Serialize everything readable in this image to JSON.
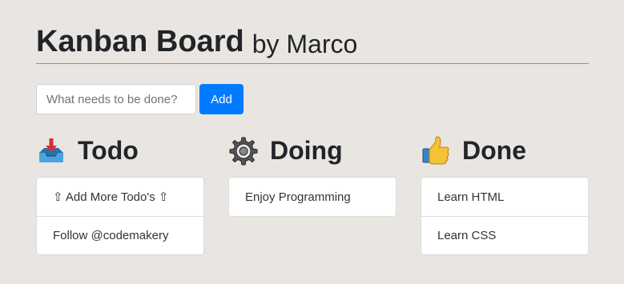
{
  "header": {
    "title": "Kanban Board",
    "subtitle": "by Marco"
  },
  "add_form": {
    "placeholder": "What needs to be done?",
    "value": "",
    "button_label": "Add",
    "button_color": "#007bff"
  },
  "columns": [
    {
      "title": "Todo",
      "icon": "inbox-tray-icon",
      "items": [
        "⇧ Add More Todo's ⇧",
        "Follow @codemakery"
      ]
    },
    {
      "title": "Doing",
      "icon": "gear-icon",
      "items": [
        "Enjoy Programming"
      ]
    },
    {
      "title": "Done",
      "icon": "thumbs-up-icon",
      "items": [
        "Learn HTML",
        "Learn CSS"
      ]
    }
  ],
  "colors": {
    "background": "#e9e6e1",
    "accent": "#007bff"
  }
}
